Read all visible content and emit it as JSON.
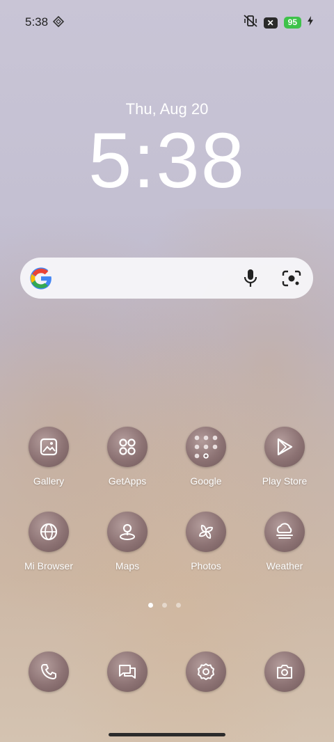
{
  "status_bar": {
    "time": "5:38",
    "battery": "95"
  },
  "lock": {
    "date": "Thu, Aug 20",
    "time": "5:38"
  },
  "search": {
    "icon": "google-g-icon"
  },
  "apps": [
    {
      "label": "Gallery",
      "icon": "gallery-icon"
    },
    {
      "label": "GetApps",
      "icon": "getapps-icon"
    },
    {
      "label": "Google",
      "icon": "google-folder-icon"
    },
    {
      "label": "Play Store",
      "icon": "play-store-icon"
    },
    {
      "label": "Mi Browser",
      "icon": "globe-icon"
    },
    {
      "label": "Maps",
      "icon": "map-pin-icon"
    },
    {
      "label": "Photos",
      "icon": "pinwheel-icon"
    },
    {
      "label": "Weather",
      "icon": "weather-icon"
    }
  ],
  "dock": [
    {
      "icon": "phone-icon"
    },
    {
      "icon": "messages-icon"
    },
    {
      "icon": "settings-icon"
    },
    {
      "icon": "camera-icon"
    }
  ],
  "page_indicator": {
    "count": 3,
    "active": 1
  },
  "colors": {
    "icon_bg": "#8c7273",
    "battery": "#3ec24a"
  }
}
